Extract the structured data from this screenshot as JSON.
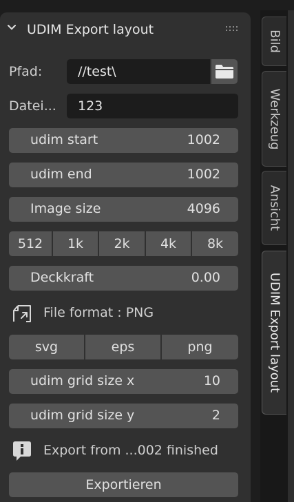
{
  "panel": {
    "title": "UDIM Export layout",
    "pfad_label": "Pfad:",
    "pfad_value": "//test\\",
    "datei_label": "Datei...",
    "datei_value": "123",
    "udim_start": {
      "label": "udim start",
      "value": "1002"
    },
    "udim_end": {
      "label": "udim end",
      "value": "1002"
    },
    "image_size": {
      "label": "Image size",
      "value": "4096"
    },
    "size_presets": [
      "512",
      "1k",
      "2k",
      "4k",
      "8k"
    ],
    "deckkraft": {
      "label": "Deckkraft",
      "value": "0.00"
    },
    "file_format": "File format : PNG",
    "formats": [
      "svg",
      "eps",
      "png"
    ],
    "grid_x": {
      "label": "udim grid size x",
      "value": "10"
    },
    "grid_y": {
      "label": "udim grid size y",
      "value": "2"
    },
    "info_text": "Export from ...002 finished",
    "export_button": "Exportieren"
  },
  "tabs": [
    "Bild",
    "Werkzeug",
    "Ansicht",
    "UDIM Export layout"
  ],
  "active_tab": "UDIM Export layout",
  "icons": [
    "chevron-down-icon",
    "drag-grip-icon",
    "folder-icon",
    "file-format-icon",
    "info-icon"
  ]
}
